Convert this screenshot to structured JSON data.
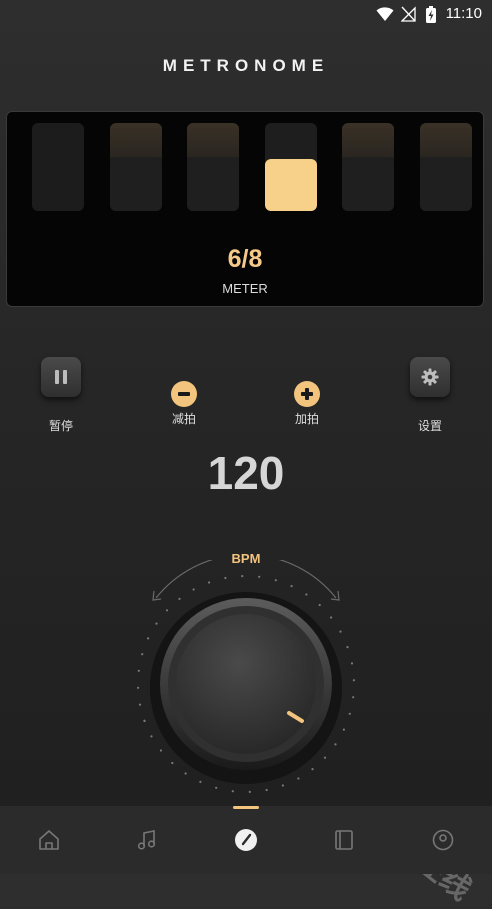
{
  "status_bar": {
    "time": "11:10",
    "icons": [
      "wifi-icon",
      "signal-off-icon",
      "battery-charging-icon"
    ]
  },
  "header": {
    "title": "METRONOME"
  },
  "beat_display": {
    "beat_count": 6,
    "active_beat": 4,
    "meter_value": "6/8",
    "meter_label": "METER"
  },
  "controls": {
    "pause_label": "暂停",
    "decrease_beat_label": "减拍",
    "increase_beat_label": "加拍",
    "settings_label": "设置"
  },
  "tempo": {
    "bpm_value": "120",
    "bpm_label": "BPM"
  },
  "nav": {
    "items": [
      "home-icon",
      "music-icon",
      "metronome-icon",
      "book-icon",
      "profile-icon"
    ],
    "active_index": 2
  },
  "watermark": "日升在线",
  "colors": {
    "accent": "#f3c47d",
    "active_beat": "#f7d08a",
    "background": "#262626"
  }
}
